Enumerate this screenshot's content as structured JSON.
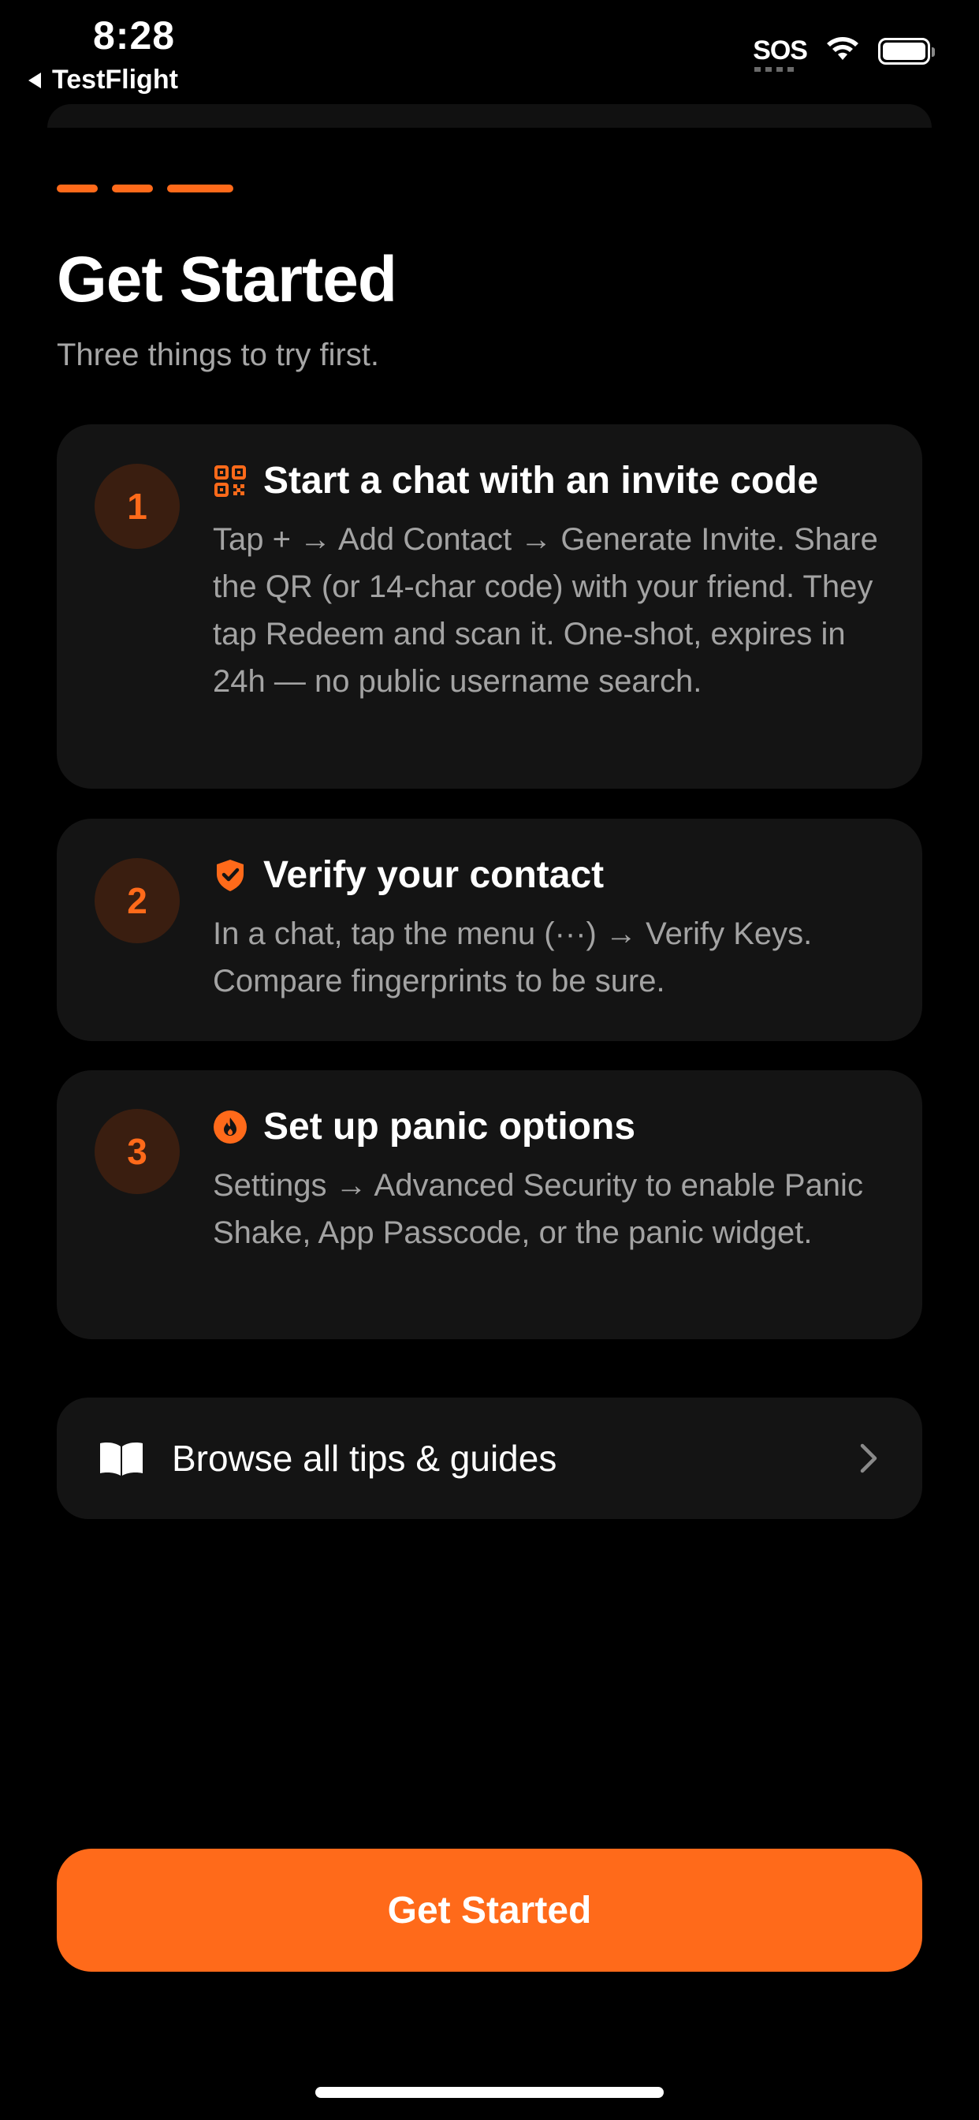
{
  "status_bar": {
    "time": "8:28",
    "back_label": "TestFlight",
    "sos": "SOS"
  },
  "colors": {
    "accent": "#ff6a1a",
    "background": "#000000",
    "card": "#141414",
    "muted_text": "#a3a3a3",
    "number_circle": "#3a1e10"
  },
  "progress": {
    "steps_total": 3,
    "current_step": 3
  },
  "header": {
    "title": "Get Started",
    "subtitle": "Three things to try first."
  },
  "cards": [
    {
      "number": "1",
      "icon": "qr-code-icon",
      "title": "Start a chat with an invite code",
      "body": "Tap + → Add Contact → Generate Invite. Share the QR (or 14-char code) with your friend. They tap Redeem and scan it. One-shot, expires in 24h — no public username search."
    },
    {
      "number": "2",
      "icon": "shield-check-icon",
      "title": "Verify your contact",
      "body": "In a chat, tap the menu (···) → Verify Keys. Compare fingerprints to be sure."
    },
    {
      "number": "3",
      "icon": "flame-icon",
      "title": "Set up panic options",
      "body": "Settings → Advanced Security to enable Panic Shake, App Passcode, or the panic widget."
    }
  ],
  "browse": {
    "icon": "book-icon",
    "label": "Browse all tips & guides"
  },
  "cta": {
    "label": "Get Started"
  }
}
